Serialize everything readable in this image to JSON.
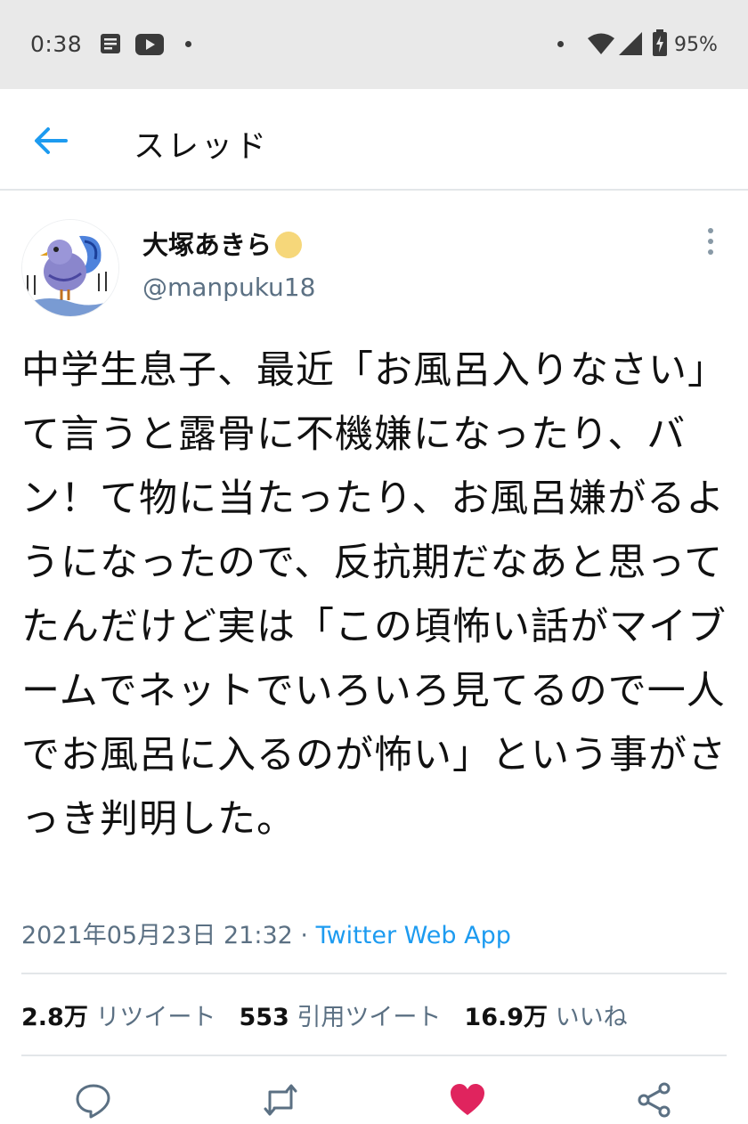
{
  "status_bar": {
    "time": "0:38",
    "battery": "95%",
    "icons": [
      "notes-icon",
      "youtube-icon",
      "dot-icon",
      "wifi-icon",
      "signal-icon",
      "battery-icon"
    ]
  },
  "header": {
    "title": "スレッド",
    "back_icon": "arrow-left-icon"
  },
  "tweet": {
    "author": {
      "name": "大塚あきら",
      "handle": "@manpuku18",
      "avatar_icon": "bluebird-avatar-icon",
      "badge_icon": "yellow-circle-badge-icon"
    },
    "text": "中学生息子、最近「お風呂入りなさい」て言うと露骨に不機嫌になったり、バン！て物に当たったり、お風呂嫌がるようになったので、反抗期だなあと思ってたんだけど実は「この頃怖い話がマイブームでネットでいろいろ見てるので一人でお風呂に入るのが怖い」という事がさっき判明した。",
    "timestamp": "2021年05月23日 21:32",
    "separator": " · ",
    "source": "Twitter Web App"
  },
  "stats": {
    "retweets": {
      "count": "2.8万",
      "label": "リツイート"
    },
    "quotes": {
      "count": "553",
      "label": "引用ツイート"
    },
    "likes": {
      "count": "16.9万",
      "label": "いいね"
    }
  },
  "actions": [
    "reply-icon",
    "retweet-icon",
    "like-icon",
    "share-icon"
  ],
  "colors": {
    "accent": "#1d9bf0",
    "like": "#e0245e",
    "secondary_text": "#5b7083",
    "status_bar_bg": "#e9e9e9"
  }
}
